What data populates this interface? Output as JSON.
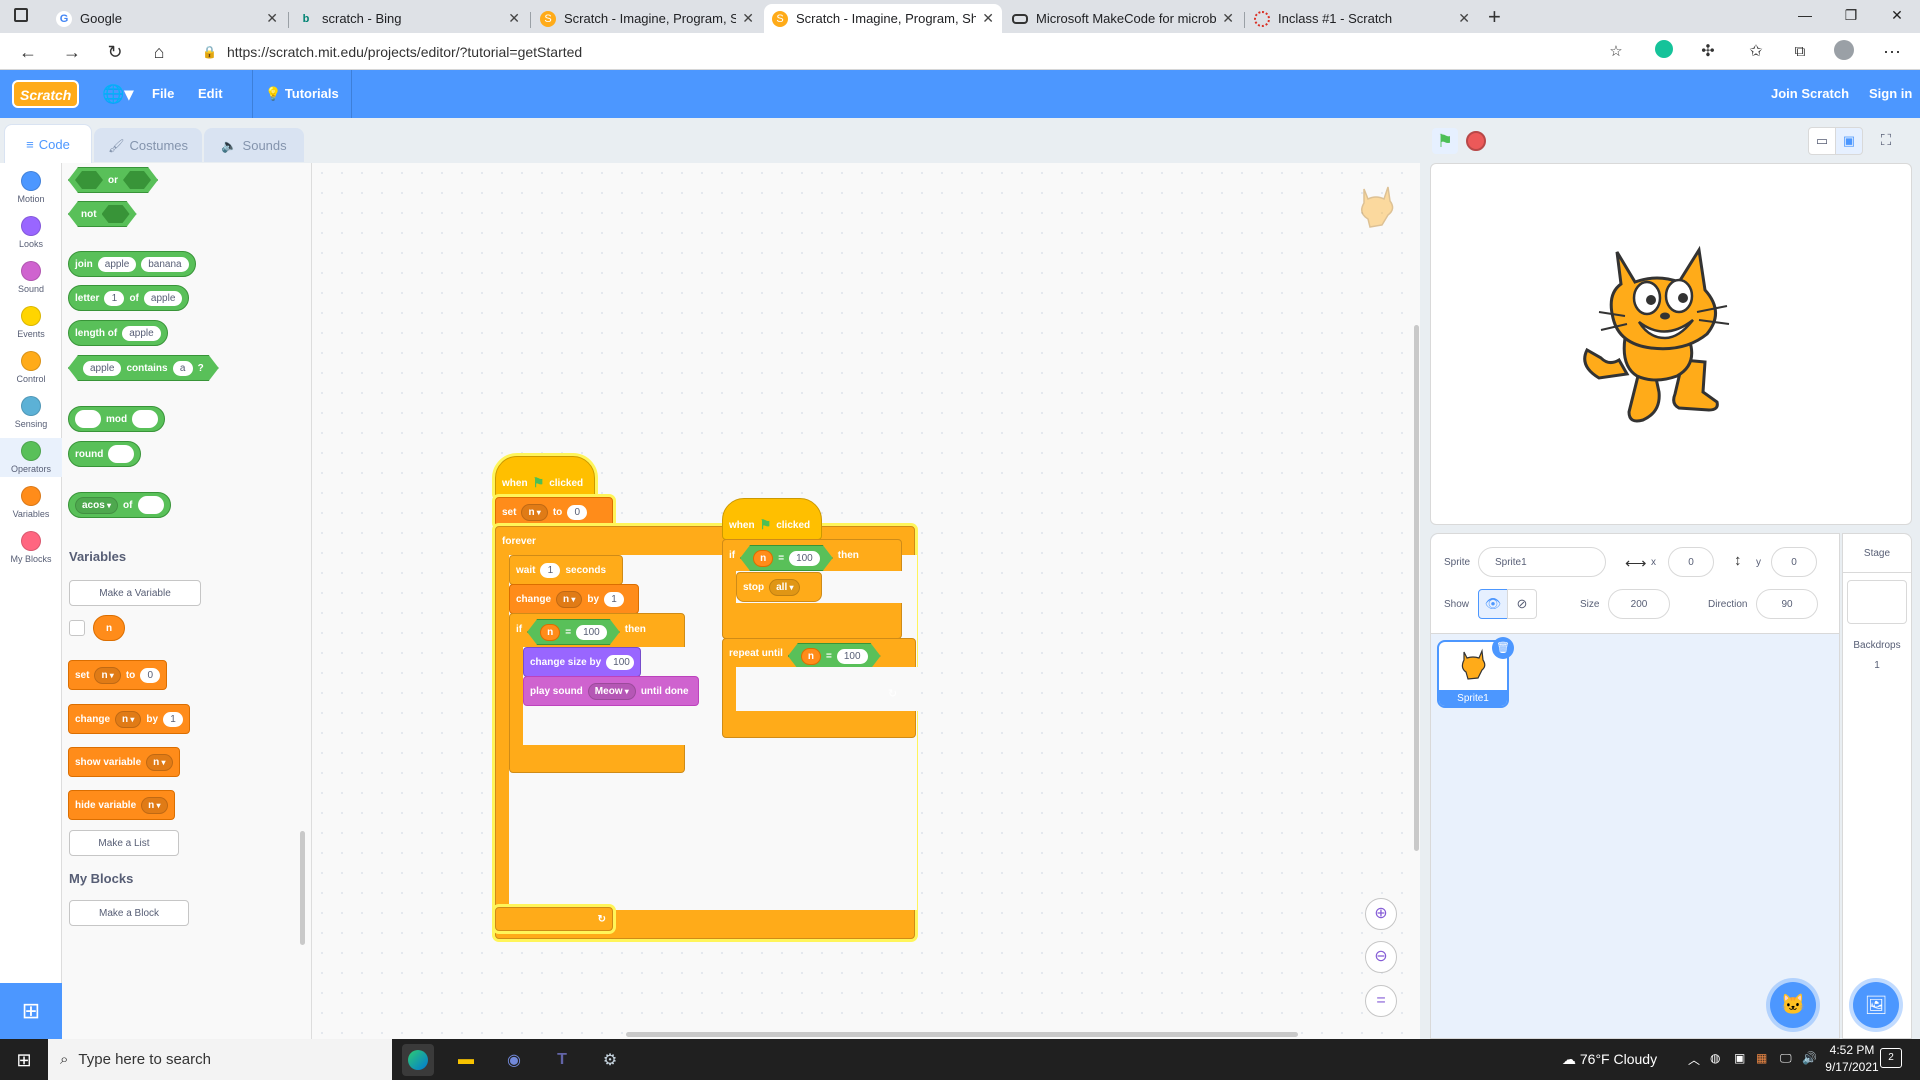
{
  "browser": {
    "tabs": [
      {
        "title": "Google",
        "icon": "google-icon"
      },
      {
        "title": "scratch - Bing",
        "icon": "bing-icon"
      },
      {
        "title": "Scratch - Imagine, Program, Sha",
        "icon": "scratch-icon"
      },
      {
        "title": "Scratch - Imagine, Program, Sha",
        "icon": "scratch-icon"
      },
      {
        "title": "Microsoft MakeCode for microb",
        "icon": "makecode-icon"
      },
      {
        "title": "Inclass #1 - Scratch",
        "icon": "loading-icon"
      }
    ],
    "active_tab_index": 3,
    "url": "https://scratch.mit.edu/projects/editor/?tutorial=getStarted"
  },
  "menu": {
    "logo": "Scratch",
    "file": "File",
    "edit": "Edit",
    "tutorials": "Tutorials",
    "join": "Join Scratch",
    "signin": "Sign in"
  },
  "editor_tabs": {
    "code": "Code",
    "costumes": "Costumes",
    "sounds": "Sounds"
  },
  "categories": [
    {
      "label": "Motion",
      "color": "#4c97ff"
    },
    {
      "label": "Looks",
      "color": "#9966ff"
    },
    {
      "label": "Sound",
      "color": "#cf63cf"
    },
    {
      "label": "Events",
      "color": "#ffd500"
    },
    {
      "label": "Control",
      "color": "#ffab19"
    },
    {
      "label": "Sensing",
      "color": "#5cb1d6"
    },
    {
      "label": "Operators",
      "color": "#59c059"
    },
    {
      "label": "Variables",
      "color": "#ff8c1a"
    },
    {
      "label": "My Blocks",
      "color": "#ff6680"
    }
  ],
  "palette": {
    "or": "or",
    "not": "not",
    "join": "join",
    "join_a": "apple",
    "join_b": "banana",
    "letter": "letter",
    "letter_n": "1",
    "letter_of": "of",
    "letter_s": "apple",
    "length": "length of",
    "length_s": "apple",
    "contains_a": "apple",
    "contains": "contains",
    "contains_b": "a",
    "contains_q": "?",
    "mod": "mod",
    "round": "round",
    "acos": "acos",
    "acos_of": "of",
    "variables_heading": "Variables",
    "make_variable": "Make a Variable",
    "var_n": "n",
    "set": "set",
    "set_var": "n",
    "set_to": "to",
    "set_val": "0",
    "change": "change",
    "change_var": "n",
    "change_by": "by",
    "change_val": "1",
    "show_variable": "show variable",
    "show_var": "n",
    "hide_variable": "hide variable",
    "hide_var": "n",
    "make_list": "Make a List",
    "myblocks_heading": "My Blocks",
    "make_block": "Make a Block"
  },
  "script1": {
    "when": "when",
    "clicked": "clicked",
    "set": "set",
    "set_var": "n",
    "to": "to",
    "set_val": "0",
    "forever": "forever",
    "wait": "wait",
    "wait_val": "1",
    "seconds": "seconds",
    "change": "change",
    "change_var": "n",
    "by": "by",
    "change_val": "1",
    "if": "if",
    "cond_var": "n",
    "eq": "=",
    "cond_val": "100",
    "then": "then",
    "change_size": "change size by",
    "size_val": "100",
    "play_sound": "play sound",
    "sound": "Meow",
    "until_done": "until done"
  },
  "script2": {
    "when": "when",
    "clicked": "clicked",
    "if": "if",
    "cond_var": "n",
    "eq": "=",
    "cond_val": "100",
    "then": "then",
    "stop": "stop",
    "stop_opt": "all",
    "repeat_until": "repeat until",
    "r_var": "n",
    "r_eq": "=",
    "r_val": "100"
  },
  "sprite_info": {
    "sprite_label": "Sprite",
    "sprite_name": "Sprite1",
    "x_label": "x",
    "x": "0",
    "y_label": "y",
    "y": "0",
    "show_label": "Show",
    "size_label": "Size",
    "size": "200",
    "direction_label": "Direction",
    "direction": "90"
  },
  "sprite_thumb": "Sprite1",
  "stage_panel": {
    "title": "Stage",
    "backdrops_label": "Backdrops",
    "backdrops_count": "1"
  },
  "taskbar": {
    "search_placeholder": "Type here to search",
    "weather": "76°F  Cloudy",
    "time": "4:52 PM",
    "date": "9/17/2021",
    "notifications": "2"
  }
}
